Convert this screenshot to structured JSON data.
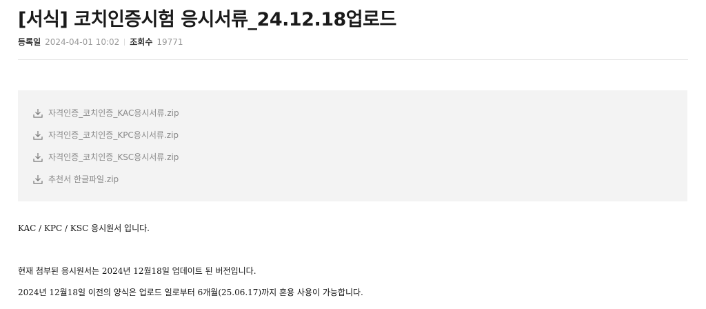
{
  "post": {
    "title": "[서식] 코치인증시험 응시서류_24.12.18업로드",
    "date_label": "등록일",
    "date": "2024-04-01 10:02",
    "views_label": "조회수",
    "views": "19771"
  },
  "attachments": [
    {
      "filename": "자격인증_코치인증_KAC응시서류.zip",
      "icon": "download-icon"
    },
    {
      "filename": "자격인증_코치인증_KPC응시서류.zip",
      "icon": "download-icon"
    },
    {
      "filename": "자격인증_코치인증_KSC응시서류.zip",
      "icon": "download-icon"
    },
    {
      "filename": "추천서 한글파일.zip",
      "icon": "download-icon"
    }
  ],
  "content": {
    "line1": "KAC / KPC / KSC  응시원서 입니다.",
    "line2": "현재 첨부된 응시원서는 2024년 12월18일 업데이트 된 버전입니다.",
    "line3": "2024년 12월18일 이전의 양식은 업로드 일로부터 6개월(25.06.17)까지 혼용 사용이 가능합니다."
  }
}
